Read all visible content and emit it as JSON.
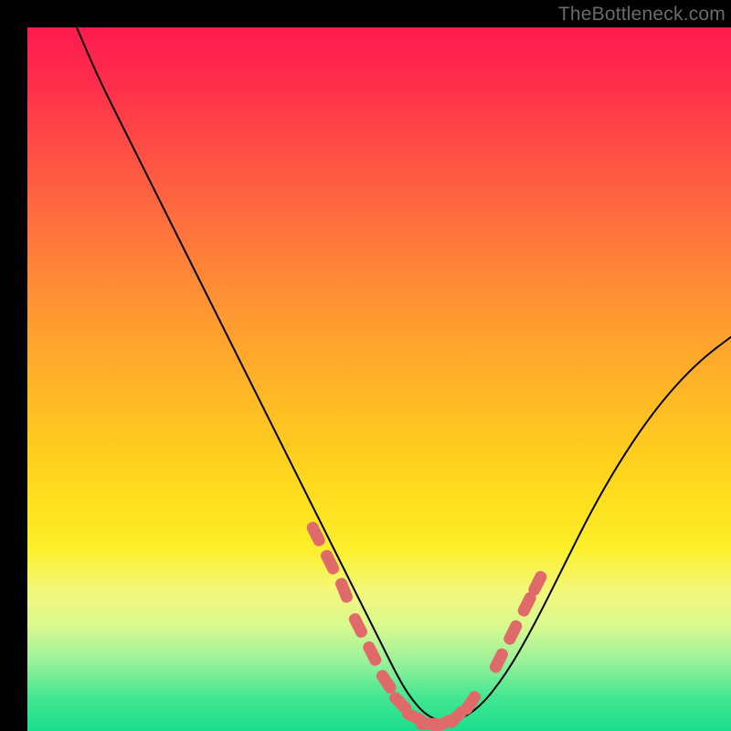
{
  "watermark": "TheBottleneck.com",
  "colors": {
    "background": "#000000",
    "gradient_top": "#ff1a4f",
    "gradient_mid_upper": "#ff8a36",
    "gradient_mid": "#ffdc1d",
    "gradient_lower": "#9bf29a",
    "gradient_bottom": "#18df8e",
    "curve_stroke": "#000000",
    "marker_fill": "#e06a6a",
    "watermark_text": "#6a6a6a"
  },
  "chart_data": {
    "type": "line",
    "title": "",
    "xlabel": "",
    "ylabel": "",
    "xlim": [
      0,
      100
    ],
    "ylim": [
      0,
      100
    ],
    "grid": false,
    "legend": false,
    "series": [
      {
        "name": "bottleneck-curve",
        "x": [
          7,
          10,
          14,
          18,
          22,
          26,
          30,
          34,
          38,
          42,
          46,
          50,
          53,
          55,
          57,
          60,
          64,
          68,
          72,
          76,
          80,
          84,
          88,
          92,
          96,
          100
        ],
        "y": [
          100,
          93,
          85,
          77,
          69,
          61,
          53,
          45,
          37,
          29,
          21,
          13,
          7,
          4,
          2,
          1,
          3,
          8,
          15,
          23,
          31,
          38,
          44,
          49,
          53,
          56
        ]
      }
    ],
    "markers": {
      "name": "highlighted-segments",
      "style": "pill",
      "color": "#e06a6a",
      "points": [
        {
          "x": 41,
          "y": 28
        },
        {
          "x": 43,
          "y": 24
        },
        {
          "x": 45,
          "y": 20
        },
        {
          "x": 47,
          "y": 15
        },
        {
          "x": 49,
          "y": 11
        },
        {
          "x": 51,
          "y": 7
        },
        {
          "x": 53,
          "y": 4
        },
        {
          "x": 55,
          "y": 2
        },
        {
          "x": 57,
          "y": 1
        },
        {
          "x": 59,
          "y": 1
        },
        {
          "x": 61,
          "y": 2
        },
        {
          "x": 63,
          "y": 4
        },
        {
          "x": 67,
          "y": 10
        },
        {
          "x": 69,
          "y": 14
        },
        {
          "x": 71,
          "y": 18
        },
        {
          "x": 72.5,
          "y": 21
        }
      ]
    }
  }
}
